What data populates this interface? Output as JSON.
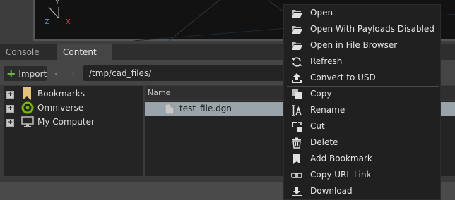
{
  "viewport": {
    "axes": {
      "y": "Y",
      "z": "Z",
      "x": "X"
    },
    "colors": {
      "y": "#b8b8b8",
      "z": "#5b8fd6",
      "x": "#d24a4a"
    }
  },
  "tabs": [
    {
      "label": "Console",
      "active": false
    },
    {
      "label": "Content",
      "active": true
    }
  ],
  "toolbar": {
    "import_label": "Import",
    "back_icon": "chevron-left-icon",
    "forward_icon": "chevron-right-icon",
    "path": "/tmp/cad_files/"
  },
  "tree": {
    "items": [
      {
        "label": "Bookmarks",
        "icon": "bookmark-icon"
      },
      {
        "label": "Omniverse",
        "icon": "omniverse-icon"
      },
      {
        "label": "My Computer",
        "icon": "computer-icon"
      }
    ]
  },
  "files": {
    "column_header": "Name",
    "rows": [
      {
        "name": "test_file.dgn",
        "selected": true
      }
    ]
  },
  "context_menu": {
    "items": [
      {
        "label": "Open",
        "icon": "folder-open-icon"
      },
      {
        "label": "Open With Payloads Disabled",
        "icon": "folder-open-icon"
      },
      {
        "label": "Open in File Browser",
        "icon": "folder-open-icon"
      },
      {
        "label": "Refresh",
        "icon": "refresh-icon"
      },
      {
        "label": "Convert to USD",
        "icon": "upload-icon"
      },
      {
        "label": "Copy",
        "icon": "copy-icon"
      },
      {
        "label": "Rename",
        "icon": "rename-icon"
      },
      {
        "label": "Cut",
        "icon": "cut-icon"
      },
      {
        "label": "Delete",
        "icon": "trash-icon"
      },
      {
        "label": "Add Bookmark",
        "icon": "bookmark-icon"
      },
      {
        "label": "Copy URL Link",
        "icon": "link-icon"
      },
      {
        "label": "Download",
        "icon": "download-icon"
      }
    ]
  }
}
